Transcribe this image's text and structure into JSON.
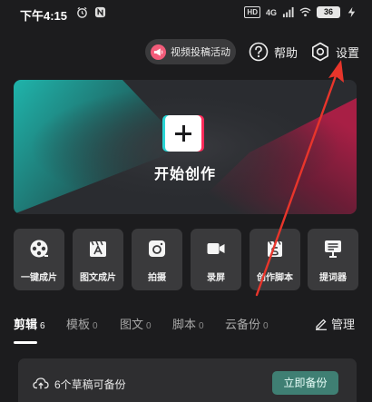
{
  "status_bar": {
    "time": "下午4:15",
    "hd": "HD",
    "signal": "4G",
    "battery": "36"
  },
  "top_actions": {
    "activity_label": "视频投稿活动",
    "help_label": "帮助",
    "settings_label": "设置"
  },
  "hero": {
    "title": "开始创作"
  },
  "tools": [
    {
      "label": "一键成片",
      "icon": "film-reel-icon"
    },
    {
      "label": "图文成片",
      "icon": "text-clapper-icon"
    },
    {
      "label": "拍摄",
      "icon": "camera-icon"
    },
    {
      "label": "录屏",
      "icon": "screen-record-icon"
    },
    {
      "label": "创作脚本",
      "icon": "script-icon"
    },
    {
      "label": "提词器",
      "icon": "teleprompter-icon"
    }
  ],
  "tabs": [
    {
      "label": "剪辑",
      "count": "6"
    },
    {
      "label": "模板",
      "count": "0"
    },
    {
      "label": "图文",
      "count": "0"
    },
    {
      "label": "脚本",
      "count": "0"
    },
    {
      "label": "云备份",
      "count": "0"
    }
  ],
  "manage_label": "管理",
  "backup": {
    "text": "6个草稿可备份",
    "button": "立即备份"
  },
  "colors": {
    "background": "#1c1c1e",
    "card": "#3a3a3c",
    "accent_teal": "#2ad5d5",
    "accent_pink": "#ff2b5a",
    "backup_button": "#3f7f73",
    "annotation": "#e8352b"
  }
}
